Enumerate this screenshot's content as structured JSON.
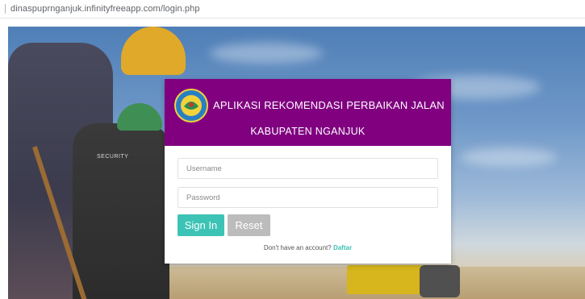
{
  "browser": {
    "url": "dinaspuprnganjuk.infinityfreeapp.com/login.php"
  },
  "background": {
    "vest_label": "SECURITY"
  },
  "login": {
    "title_line1": "APLIKASI REKOMENDASI PERBAIKAN JALAN",
    "title_line2": "KABUPATEN NGANJUK",
    "username_placeholder": "Username",
    "password_placeholder": "Password",
    "signin_label": "Sign In",
    "reset_label": "Reset",
    "register_prompt": "Don't have an account?",
    "register_link": "Daftar",
    "header_color": "#800080",
    "accent_color": "#3cc3b5",
    "logo_icon": "regency-emblem-icon"
  }
}
